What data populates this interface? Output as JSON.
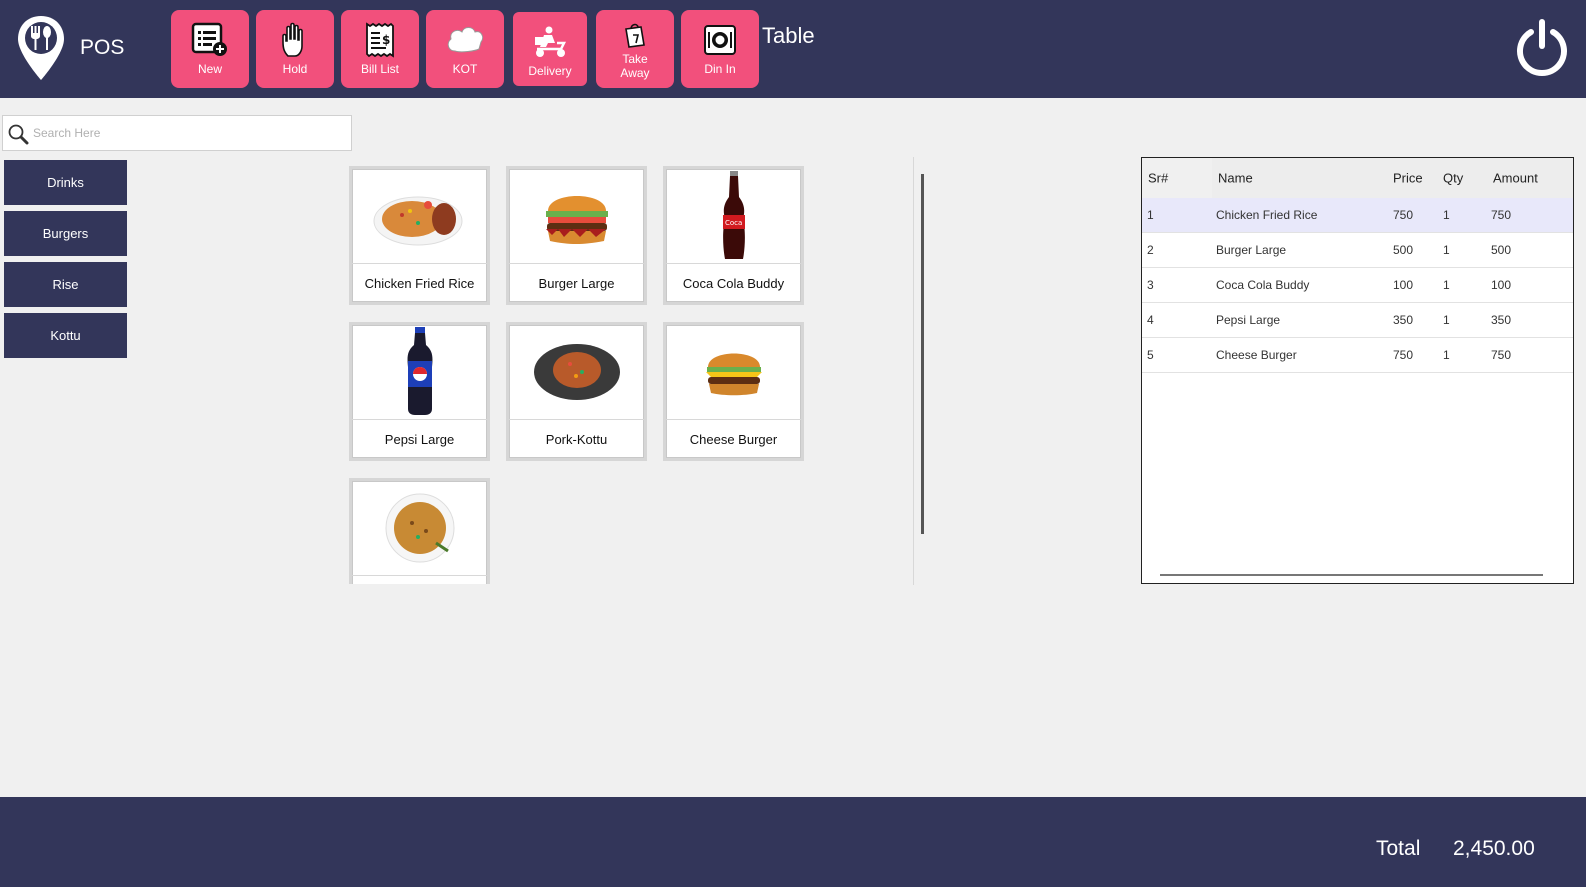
{
  "header": {
    "app_title": "POS",
    "table_label": "Table",
    "buttons": [
      {
        "label": "New",
        "icon": "new-bill-icon"
      },
      {
        "label": "Hold",
        "icon": "hand-icon"
      },
      {
        "label": "Bill List",
        "icon": "receipt-icon"
      },
      {
        "label": "KOT",
        "icon": "chef-hat-icon"
      },
      {
        "label": "Delivery",
        "icon": "delivery-scooter-icon"
      },
      {
        "label": "Take Away",
        "icon": "takeaway-bag-icon"
      },
      {
        "label": "Din In",
        "icon": "dine-in-plate-icon"
      }
    ],
    "active_button": "Delivery"
  },
  "search": {
    "placeholder": "Search Here",
    "value": ""
  },
  "categories": [
    "Drinks",
    "Burgers",
    "Rise",
    "Kottu"
  ],
  "products": [
    {
      "name": "Chicken Fried Rice",
      "icon": "fried-rice-image"
    },
    {
      "name": "Burger Large",
      "icon": "burger-image"
    },
    {
      "name": "Coca Cola Buddy",
      "icon": "coca-cola-bottle-image"
    },
    {
      "name": "Pepsi Large",
      "icon": "pepsi-bottle-image"
    },
    {
      "name": "Pork-Kottu",
      "icon": "kottu-plate-image"
    },
    {
      "name": "Cheese Burger",
      "icon": "cheese-burger-image"
    },
    {
      "name": "",
      "icon": "rice-plate-image"
    }
  ],
  "order": {
    "columns": {
      "sr": "Sr#",
      "name": "Name",
      "price": "Price",
      "qty": "Qty",
      "amount": "Amount"
    },
    "rows": [
      {
        "sr": "1",
        "name": "Chicken Fried Rice",
        "price": "750",
        "qty": "1",
        "amount": "750"
      },
      {
        "sr": "2",
        "name": "Burger Large",
        "price": "500",
        "qty": "1",
        "amount": "500"
      },
      {
        "sr": "3",
        "name": "Coca Cola Buddy",
        "price": "100",
        "qty": "1",
        "amount": "100"
      },
      {
        "sr": "4",
        "name": "Pepsi Large",
        "price": "350",
        "qty": "1",
        "amount": "350"
      },
      {
        "sr": "5",
        "name": "Cheese Burger",
        "price": "750",
        "qty": "1",
        "amount": "750"
      }
    ]
  },
  "footer": {
    "total_label": "Total",
    "total_value": "2,450.00"
  },
  "colors": {
    "navy": "#33365a",
    "pink": "#f2507c",
    "background": "#f0f0f0"
  }
}
